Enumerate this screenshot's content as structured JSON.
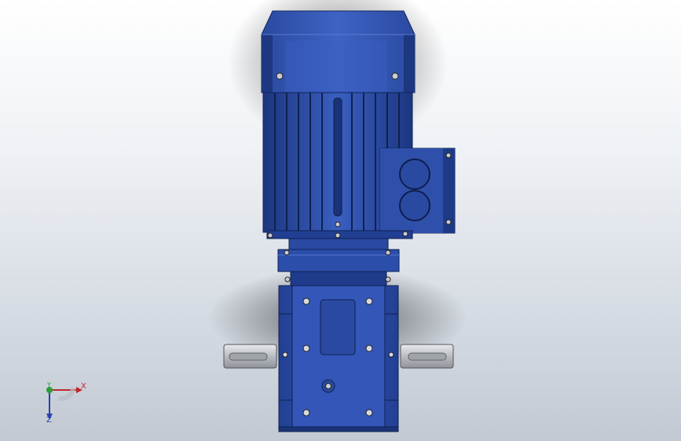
{
  "viewport": {
    "background_top": "#ffffff",
    "background_bottom": "#c2c9d2"
  },
  "model": {
    "description_visible": false,
    "body_color": "#2c4fa8",
    "body_dark": "#1b3478",
    "body_light": "#4b6fc8",
    "shaft_color": "#c9ccd1",
    "bolt_color": "#d6d9de"
  },
  "triad": {
    "x_label": "X",
    "y_label": "Y",
    "z_label": "Z",
    "x_color": "#c0282a",
    "y_color": "#2a9d3a",
    "z_color": "#2a3fb0"
  }
}
